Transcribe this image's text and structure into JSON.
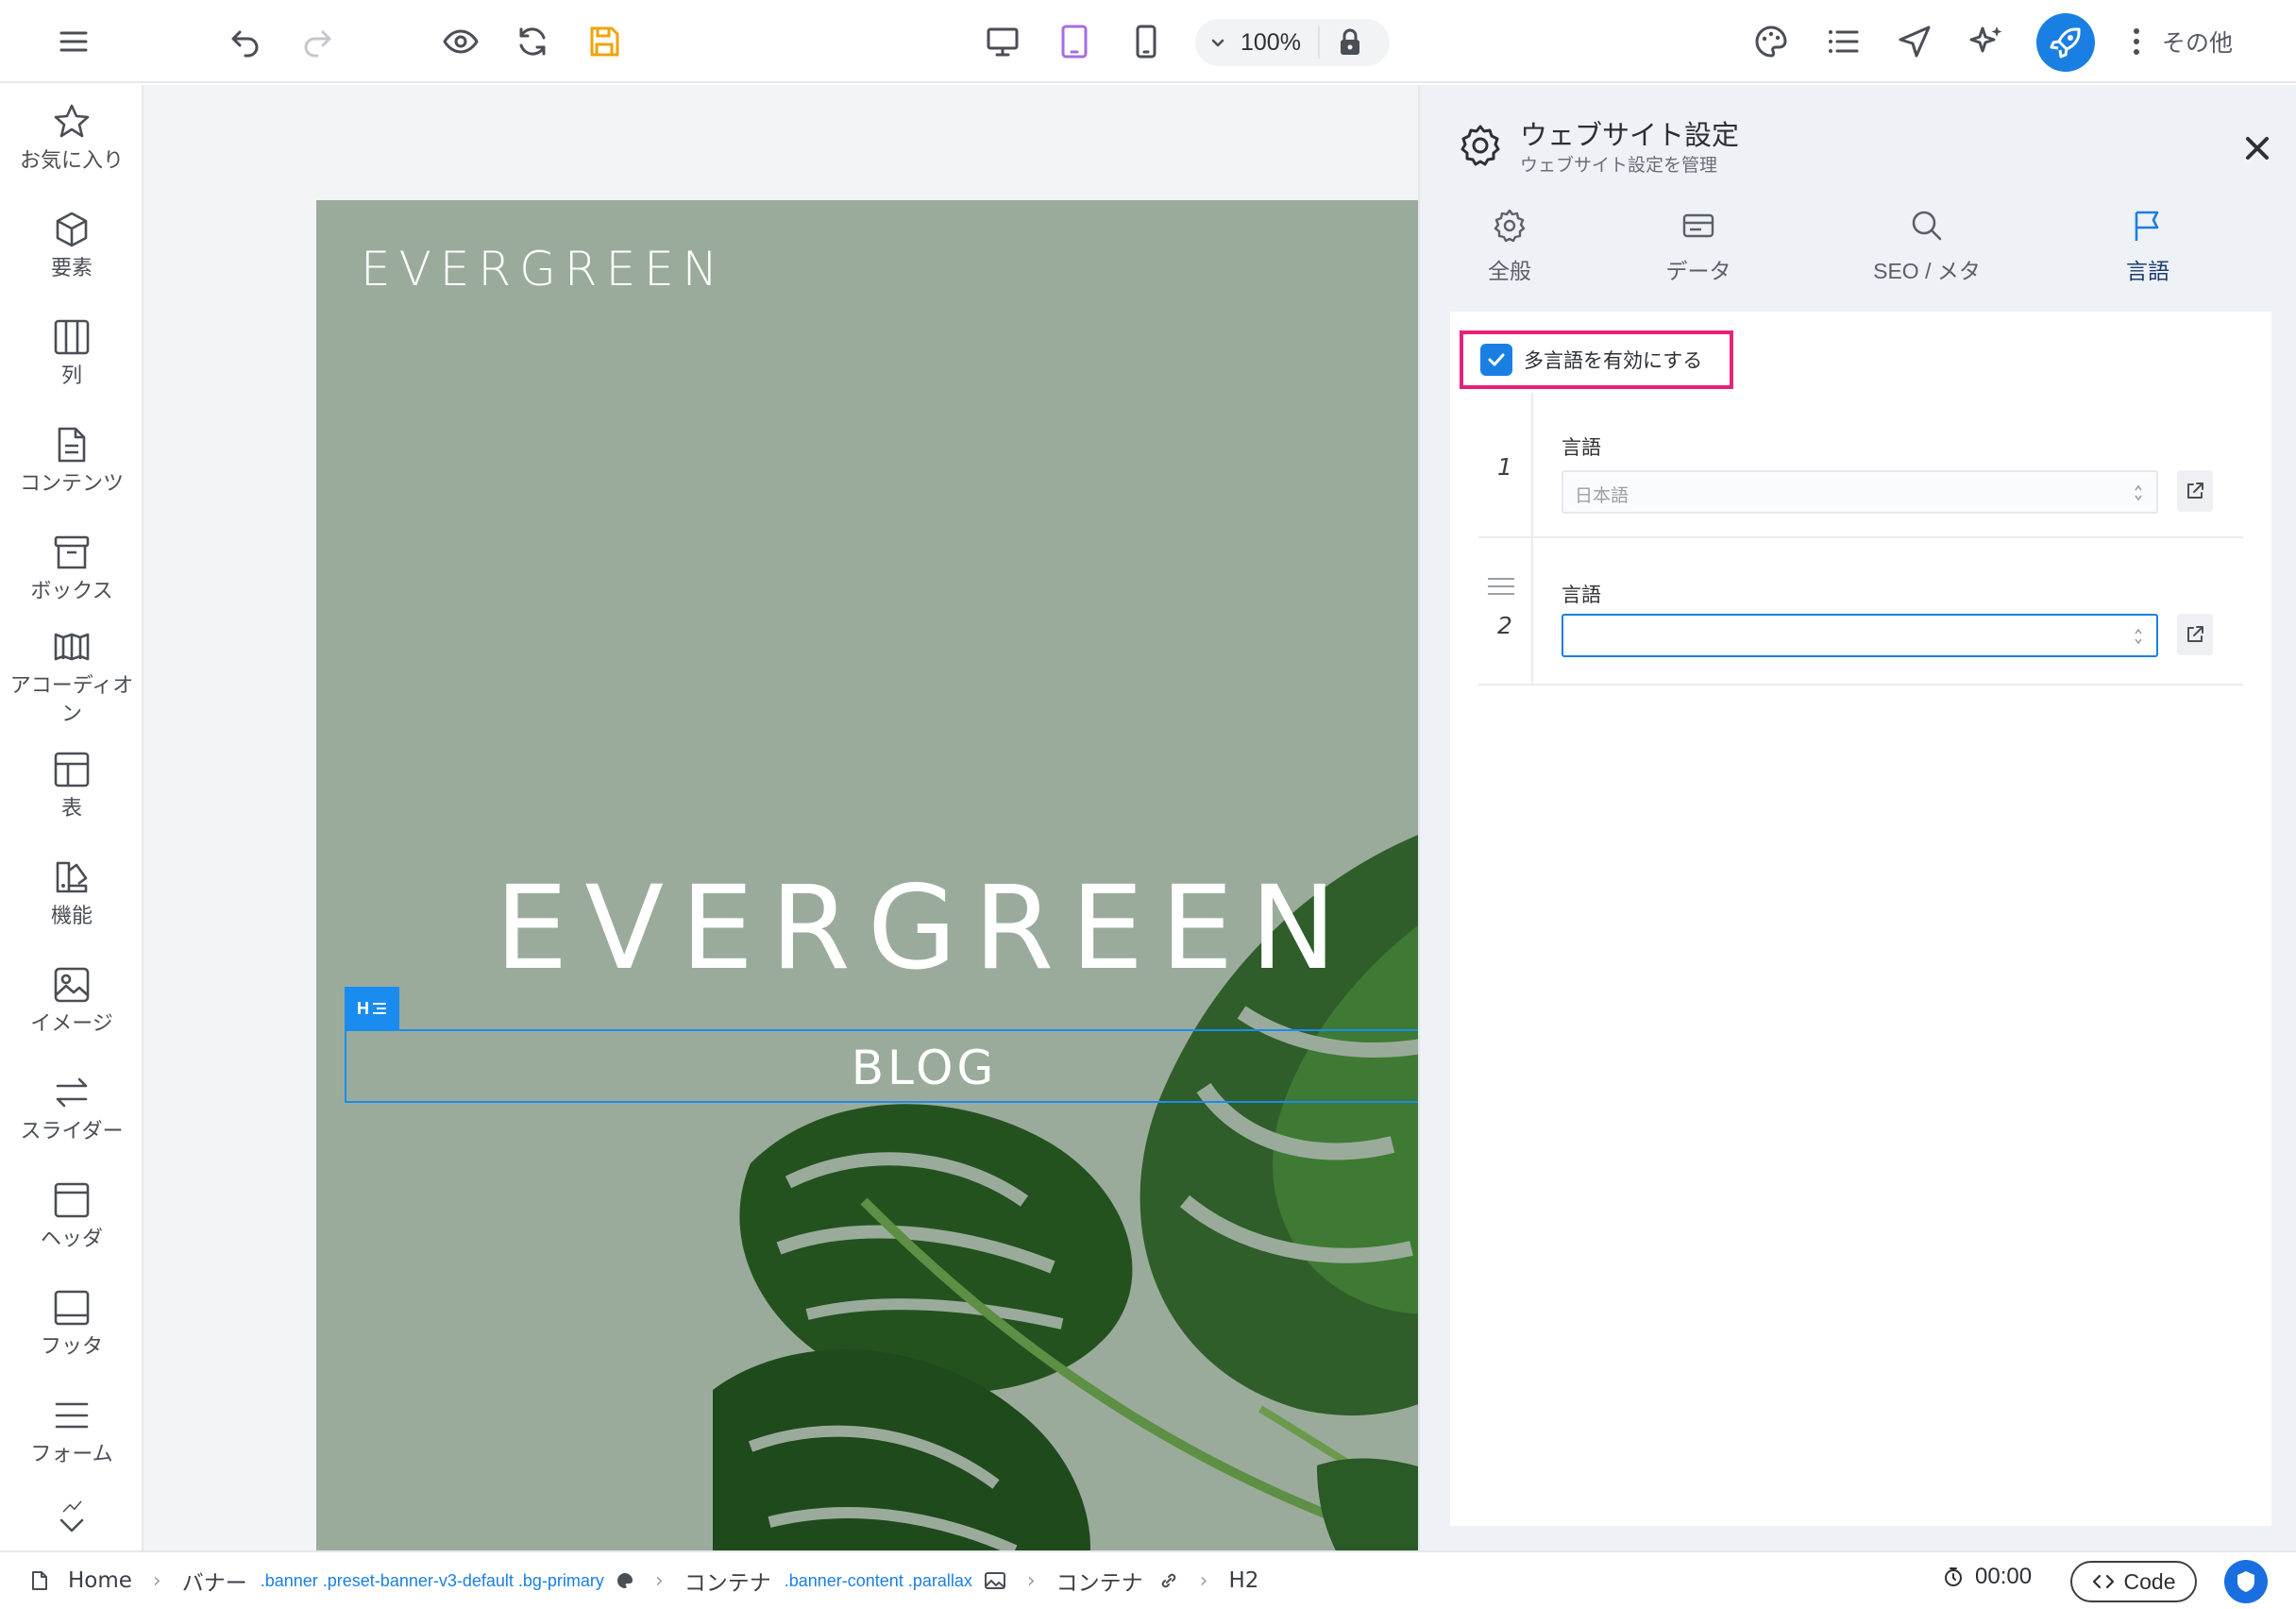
{
  "toolbar": {
    "zoom": "100%",
    "more_label": "その他",
    "active_device": "tablet"
  },
  "sidebar": {
    "items": [
      {
        "label": "お気に入り",
        "icon": "star-icon"
      },
      {
        "label": "要素",
        "icon": "cube-icon"
      },
      {
        "label": "列",
        "icon": "columns-icon"
      },
      {
        "label": "コンテンツ",
        "icon": "document-icon"
      },
      {
        "label": "ボックス",
        "icon": "archive-box-icon"
      },
      {
        "label": "アコーディオン",
        "icon": "accordion-icon"
      },
      {
        "label": "表",
        "icon": "table-icon"
      },
      {
        "label": "機能",
        "icon": "features-icon"
      },
      {
        "label": "イメージ",
        "icon": "image-icon"
      },
      {
        "label": "スライダー",
        "icon": "arrows-swap-icon"
      },
      {
        "label": "ヘッダ",
        "icon": "header-icon"
      },
      {
        "label": "フッタ",
        "icon": "footer-icon"
      },
      {
        "label": "フォーム",
        "icon": "form-icon"
      }
    ]
  },
  "canvas": {
    "logo": "EVERGREEN",
    "hero_title": "EVERGREEN",
    "blog_text": "BLOG",
    "h_tag": "H"
  },
  "panel": {
    "title": "ウェブサイト設定",
    "subtitle": "ウェブサイト設定を管理",
    "tabs": [
      {
        "label": "全般",
        "icon": "gear-icon"
      },
      {
        "label": "データ",
        "icon": "database-card-icon"
      },
      {
        "label": "SEO / メタ",
        "icon": "search-icon"
      },
      {
        "label": "言語",
        "icon": "flag-icon"
      }
    ],
    "multilang_label": "多言語を有効にする",
    "multilang_enabled": true,
    "languages": [
      {
        "num": "1",
        "label": "言語",
        "value": "日本語"
      },
      {
        "num": "2",
        "label": "言語",
        "value": ""
      }
    ]
  },
  "breadcrumb": {
    "home": "Home",
    "items": [
      {
        "label": "バナー",
        "classes": ".banner .preset-banner-v3-default .bg-primary"
      },
      {
        "label": "コンテナ",
        "classes": ".banner-content .parallax"
      },
      {
        "label": "コンテナ",
        "classes": ""
      },
      {
        "label": "H2",
        "classes": ""
      }
    ]
  },
  "status": {
    "timer": "00:00",
    "code_label": "Code"
  },
  "colors": {
    "accent": "#1a7fe3",
    "highlight_border": "#e6217a",
    "save_icon": "#f0a20a",
    "tablet_active": "#a36ee8",
    "hero_bg": "#9aab9b"
  }
}
